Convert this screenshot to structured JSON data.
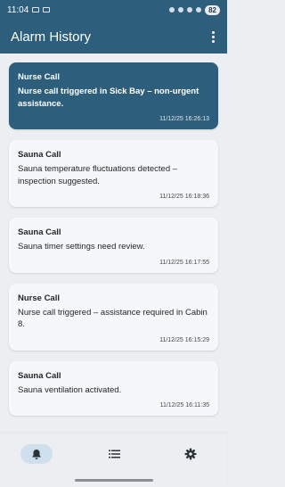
{
  "status_bar": {
    "time": "11:04",
    "battery": "82"
  },
  "app_bar": {
    "title": "Alarm History"
  },
  "alarms": [
    {
      "title": "Nurse Call",
      "message": "Nurse call triggered in Sick Bay – non-urgent assistance.",
      "timestamp": "11/12/25 16:26:13"
    },
    {
      "title": "Sauna Call",
      "message": "Sauna temperature fluctuations detected – inspection suggested.",
      "timestamp": "11/12/25 16:18:36"
    },
    {
      "title": "Sauna Call",
      "message": "Sauna timer settings need review.",
      "timestamp": "11/12/25 16:17:55"
    },
    {
      "title": "Nurse Call",
      "message": "Nurse call triggered – assistance required in Cabin 8.",
      "timestamp": "11/12/25 16:15:29"
    },
    {
      "title": "Sauna Call",
      "message": "Sauna ventilation activated.",
      "timestamp": "11/12/25 16:11:35"
    }
  ],
  "bottom_nav": {
    "items": [
      {
        "icon": "bell-icon",
        "selected": true
      },
      {
        "icon": "list-icon",
        "selected": false
      },
      {
        "icon": "gear-icon",
        "selected": false
      }
    ]
  },
  "colors": {
    "primary": "#2d5f7d",
    "background": "#eceef2",
    "card": "#f6f7f9",
    "nav_selected": "#cfe0ec"
  }
}
